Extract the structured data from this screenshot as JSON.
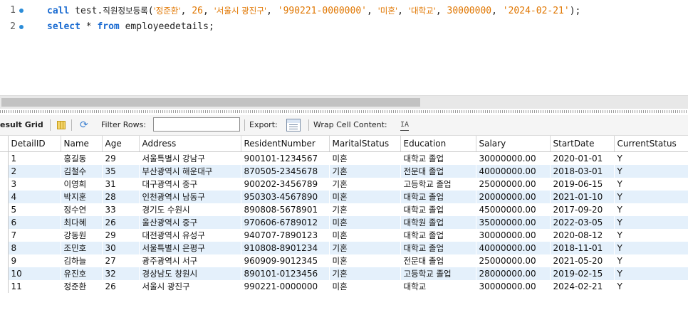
{
  "editor": {
    "lines": [
      {
        "num": "1",
        "call_kw": "call",
        "proc_schema": "test.",
        "proc_name": "직원정보등록",
        "open": "(",
        "args": [
          "'정준환'",
          "26",
          "'서울시 광진구'",
          "'990221-0000000'",
          "'미혼'",
          "'대학교'",
          "30000000",
          "'2024-02-21'"
        ],
        "close": ");"
      },
      {
        "num": "2",
        "select_kw": "select",
        "star": " * ",
        "from_kw": "from",
        "table": " employeedetails;"
      }
    ]
  },
  "toolbar": {
    "result_grid": "esult Grid",
    "filter_rows": "Filter Rows:",
    "filter_value": "",
    "export": "Export:",
    "wrap": "Wrap Cell Content:",
    "wrap_icon": "IA"
  },
  "grid": {
    "columns": [
      "DetailID",
      "Name",
      "Age",
      "Address",
      "ResidentNumber",
      "MaritalStatus",
      "Education",
      "Salary",
      "StartDate",
      "CurrentStatus"
    ],
    "rows": [
      [
        "1",
        "홍길동",
        "29",
        "서울특별시 강남구",
        "900101-1234567",
        "미혼",
        "대학교 졸업",
        "30000000.00",
        "2020-01-01",
        "Y"
      ],
      [
        "2",
        "김철수",
        "35",
        "부산광역시 해운대구",
        "870505-2345678",
        "기혼",
        "전문대 졸업",
        "40000000.00",
        "2018-03-01",
        "Y"
      ],
      [
        "3",
        "이영희",
        "31",
        "대구광역시 중구",
        "900202-3456789",
        "기혼",
        "고등학교 졸업",
        "25000000.00",
        "2019-06-15",
        "Y"
      ],
      [
        "4",
        "박지훈",
        "28",
        "인천광역시 남동구",
        "950303-4567890",
        "미혼",
        "대학교 졸업",
        "20000000.00",
        "2021-01-10",
        "Y"
      ],
      [
        "5",
        "정수연",
        "33",
        "경기도 수원시",
        "890808-5678901",
        "기혼",
        "대학교 졸업",
        "45000000.00",
        "2017-09-20",
        "Y"
      ],
      [
        "6",
        "최다혜",
        "26",
        "울산광역시 중구",
        "970606-6789012",
        "미혼",
        "대학원 졸업",
        "35000000.00",
        "2022-03-05",
        "Y"
      ],
      [
        "7",
        "강동원",
        "29",
        "대전광역시 유성구",
        "940707-7890123",
        "미혼",
        "대학교 졸업",
        "30000000.00",
        "2020-08-12",
        "Y"
      ],
      [
        "8",
        "조민호",
        "30",
        "서울특별시 은평구",
        "910808-8901234",
        "기혼",
        "대학교 졸업",
        "40000000.00",
        "2018-11-01",
        "Y"
      ],
      [
        "9",
        "김하늘",
        "27",
        "광주광역시 서구",
        "960909-9012345",
        "미혼",
        "전문대 졸업",
        "25000000.00",
        "2021-05-20",
        "Y"
      ],
      [
        "10",
        "유진호",
        "32",
        "경상남도 창원시",
        "890101-0123456",
        "기혼",
        "고등학교 졸업",
        "28000000.00",
        "2019-02-15",
        "Y"
      ],
      [
        "11",
        "정준환",
        "26",
        "서울시 광진구",
        "990221-0000000",
        "미혼",
        "대학교",
        "30000000.00",
        "2024-02-21",
        "Y"
      ]
    ]
  }
}
